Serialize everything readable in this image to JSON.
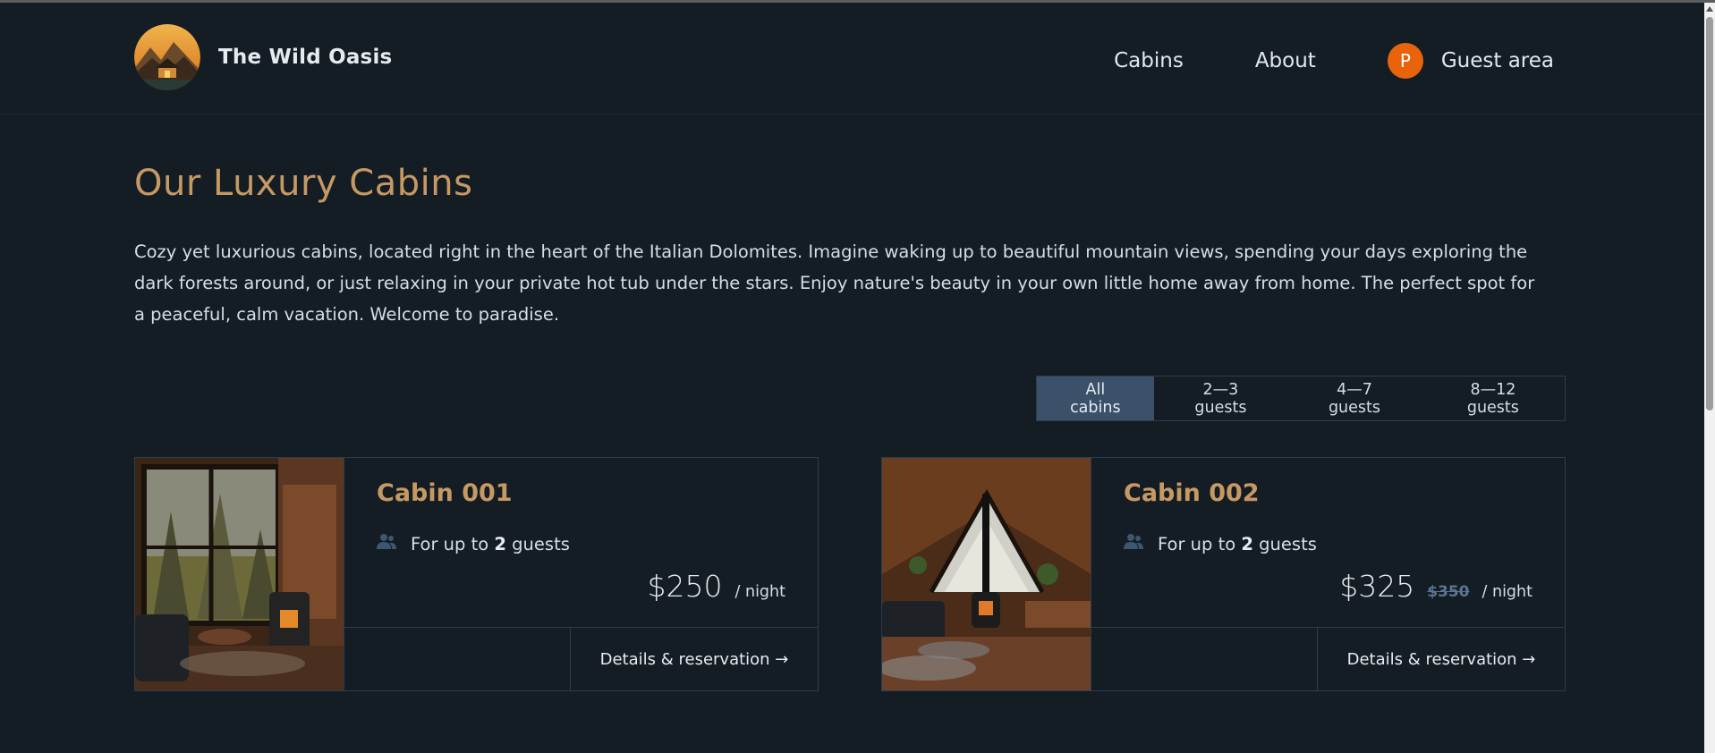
{
  "brand": {
    "name": "The Wild Oasis"
  },
  "nav": {
    "cabins": "Cabins",
    "about": "About",
    "guest_area": "Guest area",
    "avatar_initial": "P"
  },
  "page": {
    "title": "Our Luxury Cabins",
    "intro": "Cozy yet luxurious cabins, located right in the heart of the Italian Dolomites. Imagine waking up to beautiful mountain views, spending your days exploring the dark forests around, or just relaxing in your private hot tub under the stars. Enjoy nature's beauty in your own little home away from home. The perfect spot for a peaceful, calm vacation. Welcome to paradise."
  },
  "filters": {
    "all": "All cabins",
    "small": "2—3 guests",
    "medium": "4—7 guests",
    "large": "8—12 guests",
    "active": "All cabins"
  },
  "cabins": [
    {
      "name": "Cabin 001",
      "guests_prefix": "For up to",
      "guests_count": "2",
      "guests_suffix": "guests",
      "price": "$250",
      "old_price": "",
      "per": "/ night",
      "details": "Details & reservation →"
    },
    {
      "name": "Cabin 002",
      "guests_prefix": "For up to",
      "guests_count": "2",
      "guests_suffix": "guests",
      "price": "$325",
      "old_price": "$350",
      "per": "/ night",
      "details": "Details & reservation →"
    }
  ],
  "icons": {
    "guests": "users-icon",
    "logo": "mountain-cabin-logo"
  },
  "colors": {
    "background": "#141c24",
    "accent": "#c69963",
    "filter_active": "#3a5169",
    "avatar": "#e8630a"
  }
}
